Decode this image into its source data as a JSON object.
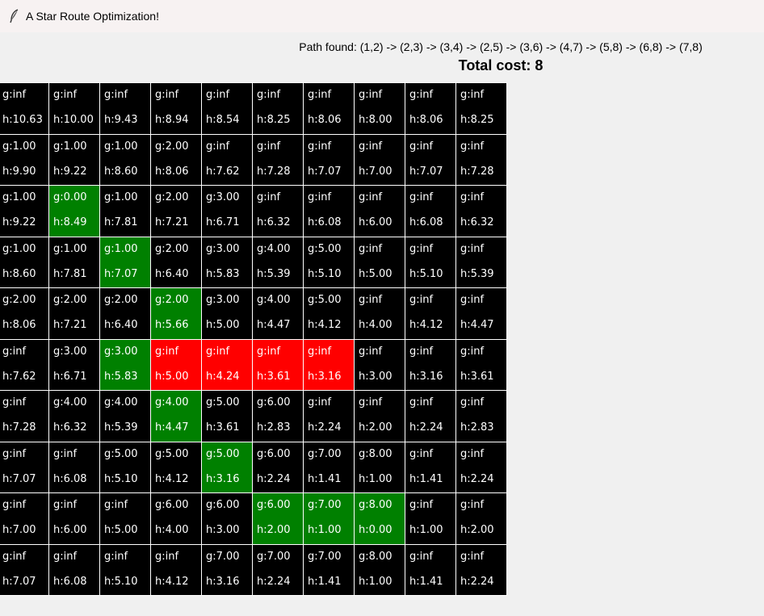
{
  "window": {
    "title": "A Star Route Optimization!",
    "icon": "feather-icon"
  },
  "result": {
    "path_text": "Path found: (1,2) -> (2,3) -> (3,4) -> (2,5) -> (3,6) -> (4,7) -> (5,8) -> (6,8) -> (7,8)",
    "cost_text": "Total cost: 8"
  },
  "colors": {
    "empty": "#000000",
    "path": "#008000",
    "wall": "#ff0000",
    "text": "#ffffff"
  },
  "grid": [
    [
      {
        "g": "g:inf",
        "h": "h:10.63",
        "state": "empty"
      },
      {
        "g": "g:inf",
        "h": "h:10.00",
        "state": "empty"
      },
      {
        "g": "g:inf",
        "h": "h:9.43",
        "state": "empty"
      },
      {
        "g": "g:inf",
        "h": "h:8.94",
        "state": "empty"
      },
      {
        "g": "g:inf",
        "h": "h:8.54",
        "state": "empty"
      },
      {
        "g": "g:inf",
        "h": "h:8.25",
        "state": "empty"
      },
      {
        "g": "g:inf",
        "h": "h:8.06",
        "state": "empty"
      },
      {
        "g": "g:inf",
        "h": "h:8.00",
        "state": "empty"
      },
      {
        "g": "g:inf",
        "h": "h:8.06",
        "state": "empty"
      },
      {
        "g": "g:inf",
        "h": "h:8.25",
        "state": "empty"
      }
    ],
    [
      {
        "g": "g:1.00",
        "h": "h:9.90",
        "state": "empty"
      },
      {
        "g": "g:1.00",
        "h": "h:9.22",
        "state": "empty"
      },
      {
        "g": "g:1.00",
        "h": "h:8.60",
        "state": "empty"
      },
      {
        "g": "g:2.00",
        "h": "h:8.06",
        "state": "empty"
      },
      {
        "g": "g:inf",
        "h": "h:7.62",
        "state": "empty"
      },
      {
        "g": "g:inf",
        "h": "h:7.28",
        "state": "empty"
      },
      {
        "g": "g:inf",
        "h": "h:7.07",
        "state": "empty"
      },
      {
        "g": "g:inf",
        "h": "h:7.00",
        "state": "empty"
      },
      {
        "g": "g:inf",
        "h": "h:7.07",
        "state": "empty"
      },
      {
        "g": "g:inf",
        "h": "h:7.28",
        "state": "empty"
      }
    ],
    [
      {
        "g": "g:1.00",
        "h": "h:9.22",
        "state": "empty"
      },
      {
        "g": "g:0.00",
        "h": "h:8.49",
        "state": "path"
      },
      {
        "g": "g:1.00",
        "h": "h:7.81",
        "state": "empty"
      },
      {
        "g": "g:2.00",
        "h": "h:7.21",
        "state": "empty"
      },
      {
        "g": "g:3.00",
        "h": "h:6.71",
        "state": "empty"
      },
      {
        "g": "g:inf",
        "h": "h:6.32",
        "state": "empty"
      },
      {
        "g": "g:inf",
        "h": "h:6.08",
        "state": "empty"
      },
      {
        "g": "g:inf",
        "h": "h:6.00",
        "state": "empty"
      },
      {
        "g": "g:inf",
        "h": "h:6.08",
        "state": "empty"
      },
      {
        "g": "g:inf",
        "h": "h:6.32",
        "state": "empty"
      }
    ],
    [
      {
        "g": "g:1.00",
        "h": "h:8.60",
        "state": "empty"
      },
      {
        "g": "g:1.00",
        "h": "h:7.81",
        "state": "empty"
      },
      {
        "g": "g:1.00",
        "h": "h:7.07",
        "state": "path"
      },
      {
        "g": "g:2.00",
        "h": "h:6.40",
        "state": "empty"
      },
      {
        "g": "g:3.00",
        "h": "h:5.83",
        "state": "empty"
      },
      {
        "g": "g:4.00",
        "h": "h:5.39",
        "state": "empty"
      },
      {
        "g": "g:5.00",
        "h": "h:5.10",
        "state": "empty"
      },
      {
        "g": "g:inf",
        "h": "h:5.00",
        "state": "empty"
      },
      {
        "g": "g:inf",
        "h": "h:5.10",
        "state": "empty"
      },
      {
        "g": "g:inf",
        "h": "h:5.39",
        "state": "empty"
      }
    ],
    [
      {
        "g": "g:2.00",
        "h": "h:8.06",
        "state": "empty"
      },
      {
        "g": "g:2.00",
        "h": "h:7.21",
        "state": "empty"
      },
      {
        "g": "g:2.00",
        "h": "h:6.40",
        "state": "empty"
      },
      {
        "g": "g:2.00",
        "h": "h:5.66",
        "state": "path"
      },
      {
        "g": "g:3.00",
        "h": "h:5.00",
        "state": "empty"
      },
      {
        "g": "g:4.00",
        "h": "h:4.47",
        "state": "empty"
      },
      {
        "g": "g:5.00",
        "h": "h:4.12",
        "state": "empty"
      },
      {
        "g": "g:inf",
        "h": "h:4.00",
        "state": "empty"
      },
      {
        "g": "g:inf",
        "h": "h:4.12",
        "state": "empty"
      },
      {
        "g": "g:inf",
        "h": "h:4.47",
        "state": "empty"
      }
    ],
    [
      {
        "g": "g:inf",
        "h": "h:7.62",
        "state": "empty"
      },
      {
        "g": "g:3.00",
        "h": "h:6.71",
        "state": "empty"
      },
      {
        "g": "g:3.00",
        "h": "h:5.83",
        "state": "path"
      },
      {
        "g": "g:inf",
        "h": "h:5.00",
        "state": "wall"
      },
      {
        "g": "g:inf",
        "h": "h:4.24",
        "state": "wall"
      },
      {
        "g": "g:inf",
        "h": "h:3.61",
        "state": "wall"
      },
      {
        "g": "g:inf",
        "h": "h:3.16",
        "state": "wall"
      },
      {
        "g": "g:inf",
        "h": "h:3.00",
        "state": "empty"
      },
      {
        "g": "g:inf",
        "h": "h:3.16",
        "state": "empty"
      },
      {
        "g": "g:inf",
        "h": "h:3.61",
        "state": "empty"
      }
    ],
    [
      {
        "g": "g:inf",
        "h": "h:7.28",
        "state": "empty"
      },
      {
        "g": "g:4.00",
        "h": "h:6.32",
        "state": "empty"
      },
      {
        "g": "g:4.00",
        "h": "h:5.39",
        "state": "empty"
      },
      {
        "g": "g:4.00",
        "h": "h:4.47",
        "state": "path"
      },
      {
        "g": "g:5.00",
        "h": "h:3.61",
        "state": "empty"
      },
      {
        "g": "g:6.00",
        "h": "h:2.83",
        "state": "empty"
      },
      {
        "g": "g:inf",
        "h": "h:2.24",
        "state": "empty"
      },
      {
        "g": "g:inf",
        "h": "h:2.00",
        "state": "empty"
      },
      {
        "g": "g:inf",
        "h": "h:2.24",
        "state": "empty"
      },
      {
        "g": "g:inf",
        "h": "h:2.83",
        "state": "empty"
      }
    ],
    [
      {
        "g": "g:inf",
        "h": "h:7.07",
        "state": "empty"
      },
      {
        "g": "g:inf",
        "h": "h:6.08",
        "state": "empty"
      },
      {
        "g": "g:5.00",
        "h": "h:5.10",
        "state": "empty"
      },
      {
        "g": "g:5.00",
        "h": "h:4.12",
        "state": "empty"
      },
      {
        "g": "g:5.00",
        "h": "h:3.16",
        "state": "path"
      },
      {
        "g": "g:6.00",
        "h": "h:2.24",
        "state": "empty"
      },
      {
        "g": "g:7.00",
        "h": "h:1.41",
        "state": "empty"
      },
      {
        "g": "g:8.00",
        "h": "h:1.00",
        "state": "empty"
      },
      {
        "g": "g:inf",
        "h": "h:1.41",
        "state": "empty"
      },
      {
        "g": "g:inf",
        "h": "h:2.24",
        "state": "empty"
      }
    ],
    [
      {
        "g": "g:inf",
        "h": "h:7.00",
        "state": "empty"
      },
      {
        "g": "g:inf",
        "h": "h:6.00",
        "state": "empty"
      },
      {
        "g": "g:inf",
        "h": "h:5.00",
        "state": "empty"
      },
      {
        "g": "g:6.00",
        "h": "h:4.00",
        "state": "empty"
      },
      {
        "g": "g:6.00",
        "h": "h:3.00",
        "state": "empty"
      },
      {
        "g": "g:6.00",
        "h": "h:2.00",
        "state": "path"
      },
      {
        "g": "g:7.00",
        "h": "h:1.00",
        "state": "path"
      },
      {
        "g": "g:8.00",
        "h": "h:0.00",
        "state": "path"
      },
      {
        "g": "g:inf",
        "h": "h:1.00",
        "state": "empty"
      },
      {
        "g": "g:inf",
        "h": "h:2.00",
        "state": "empty"
      }
    ],
    [
      {
        "g": "g:inf",
        "h": "h:7.07",
        "state": "empty"
      },
      {
        "g": "g:inf",
        "h": "h:6.08",
        "state": "empty"
      },
      {
        "g": "g:inf",
        "h": "h:5.10",
        "state": "empty"
      },
      {
        "g": "g:inf",
        "h": "h:4.12",
        "state": "empty"
      },
      {
        "g": "g:7.00",
        "h": "h:3.16",
        "state": "empty"
      },
      {
        "g": "g:7.00",
        "h": "h:2.24",
        "state": "empty"
      },
      {
        "g": "g:7.00",
        "h": "h:1.41",
        "state": "empty"
      },
      {
        "g": "g:8.00",
        "h": "h:1.00",
        "state": "empty"
      },
      {
        "g": "g:inf",
        "h": "h:1.41",
        "state": "empty"
      },
      {
        "g": "g:inf",
        "h": "h:2.24",
        "state": "empty"
      }
    ]
  ]
}
